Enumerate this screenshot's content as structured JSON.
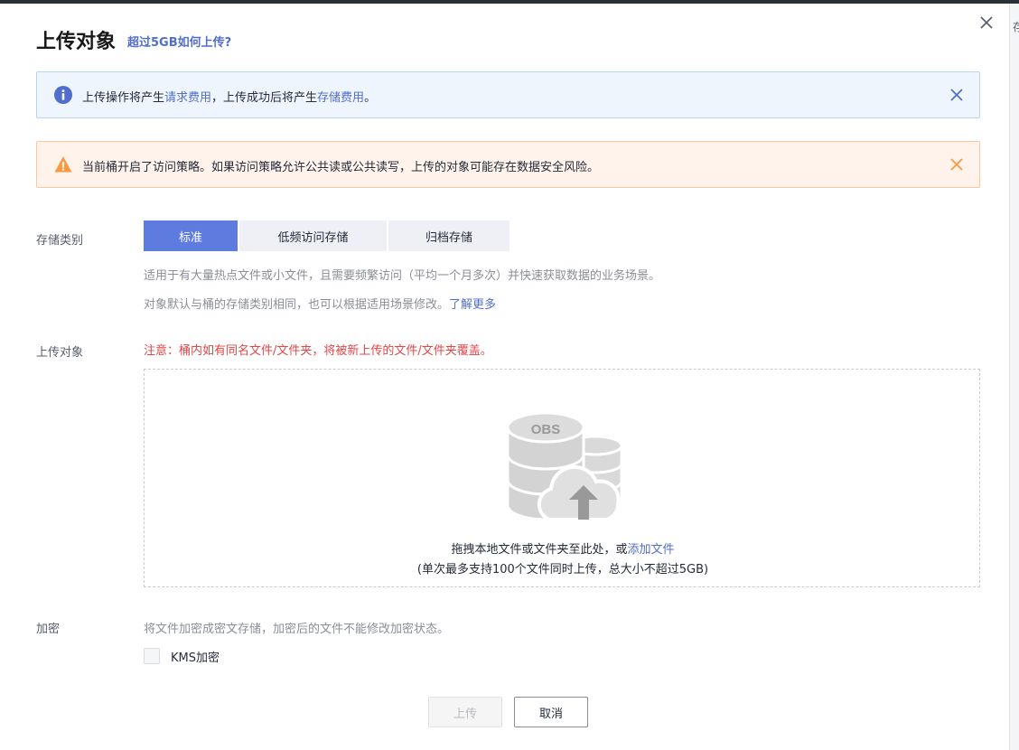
{
  "dialog": {
    "title": "上传对象",
    "title_link": "超过5GB如何上传?"
  },
  "side_text": "存",
  "info_alert": {
    "text_before": "上传操作将产生",
    "link1": "请求费用",
    "text_middle": "，上传成功后将产生",
    "link2": "存储费用",
    "text_after": "。"
  },
  "warn_alert": {
    "text": "当前桶开启了访问策略。如果访问策略允许公共读或公共读写，上传的对象可能存在数据安全风险。"
  },
  "storage_class": {
    "label": "存储类别",
    "options": [
      "标准",
      "低频访问存储",
      "归档存储"
    ],
    "selected": "标准",
    "desc1": "适用于有大量热点文件或小文件，且需要频繁访问（平均一个月多次）并快速获取数据的业务场景。",
    "desc2": "对象默认与桶的存储类别相同，也可以根据适用场景修改。",
    "learn_more": "了解更多"
  },
  "upload_object": {
    "label": "上传对象",
    "notice": "注意：桶内如有同名文件/文件夹，将被新上传的文件/文件夹覆盖。",
    "graphic_text": "OBS",
    "drop_text": "拖拽本地文件或文件夹至此处，或",
    "add_file": "添加文件",
    "limit_text": "(单次最多支持100个文件同时上传，总大小不超过5GB)"
  },
  "encryption": {
    "label": "加密",
    "desc": "将文件加密成密文存储，加密后的文件不能修改加密状态。",
    "kms_label": "KMS加密",
    "kms_checked": false
  },
  "buttons": {
    "upload": "上传",
    "cancel": "取消"
  },
  "colors": {
    "accent": "#5e7ce0",
    "link": "#526ecc",
    "info_icon": "#526ecc",
    "warn_icon": "#fa9841",
    "danger_text": "#e54545"
  }
}
